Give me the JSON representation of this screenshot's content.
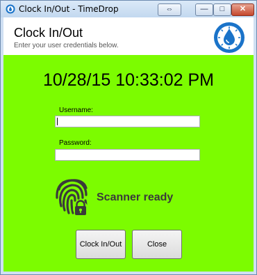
{
  "window": {
    "title": "Clock In/Out - TimeDrop",
    "controls": {
      "swap": "⇔",
      "minimize": "—",
      "maximize": "□",
      "close": "✕"
    }
  },
  "header": {
    "title": "Clock In/Out",
    "subtitle": "Enter your user credentials below.",
    "logo_icon": "water-drop-gear-icon"
  },
  "main": {
    "datetime": "10/28/15 10:33:02 PM",
    "username_label": "Username:",
    "username_value": "",
    "password_label": "Password:",
    "password_value": "",
    "scanner_icon": "fingerprint-lock-icon",
    "scanner_status": "Scanner ready",
    "clock_button": "Clock In/Out",
    "close_button": "Close"
  },
  "colors": {
    "background": "#7cfc00",
    "accent": "#1a73c9",
    "header_bg": "#ffffff"
  }
}
